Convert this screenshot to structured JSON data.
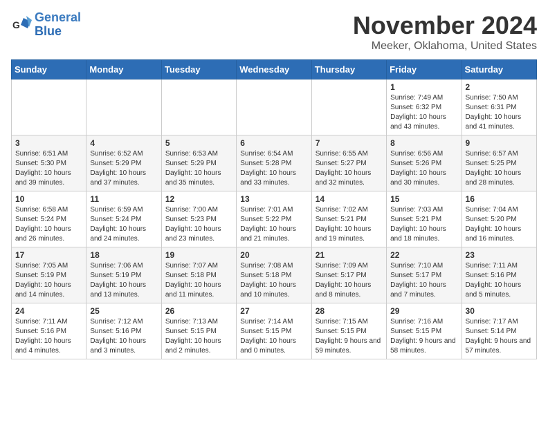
{
  "logo": {
    "line1": "General",
    "line2": "Blue"
  },
  "title": "November 2024",
  "location": "Meeker, Oklahoma, United States",
  "weekdays": [
    "Sunday",
    "Monday",
    "Tuesday",
    "Wednesday",
    "Thursday",
    "Friday",
    "Saturday"
  ],
  "weeks": [
    [
      {
        "day": "",
        "info": ""
      },
      {
        "day": "",
        "info": ""
      },
      {
        "day": "",
        "info": ""
      },
      {
        "day": "",
        "info": ""
      },
      {
        "day": "",
        "info": ""
      },
      {
        "day": "1",
        "info": "Sunrise: 7:49 AM\nSunset: 6:32 PM\nDaylight: 10 hours and 43 minutes."
      },
      {
        "day": "2",
        "info": "Sunrise: 7:50 AM\nSunset: 6:31 PM\nDaylight: 10 hours and 41 minutes."
      }
    ],
    [
      {
        "day": "3",
        "info": "Sunrise: 6:51 AM\nSunset: 5:30 PM\nDaylight: 10 hours and 39 minutes."
      },
      {
        "day": "4",
        "info": "Sunrise: 6:52 AM\nSunset: 5:29 PM\nDaylight: 10 hours and 37 minutes."
      },
      {
        "day": "5",
        "info": "Sunrise: 6:53 AM\nSunset: 5:29 PM\nDaylight: 10 hours and 35 minutes."
      },
      {
        "day": "6",
        "info": "Sunrise: 6:54 AM\nSunset: 5:28 PM\nDaylight: 10 hours and 33 minutes."
      },
      {
        "day": "7",
        "info": "Sunrise: 6:55 AM\nSunset: 5:27 PM\nDaylight: 10 hours and 32 minutes."
      },
      {
        "day": "8",
        "info": "Sunrise: 6:56 AM\nSunset: 5:26 PM\nDaylight: 10 hours and 30 minutes."
      },
      {
        "day": "9",
        "info": "Sunrise: 6:57 AM\nSunset: 5:25 PM\nDaylight: 10 hours and 28 minutes."
      }
    ],
    [
      {
        "day": "10",
        "info": "Sunrise: 6:58 AM\nSunset: 5:24 PM\nDaylight: 10 hours and 26 minutes."
      },
      {
        "day": "11",
        "info": "Sunrise: 6:59 AM\nSunset: 5:24 PM\nDaylight: 10 hours and 24 minutes."
      },
      {
        "day": "12",
        "info": "Sunrise: 7:00 AM\nSunset: 5:23 PM\nDaylight: 10 hours and 23 minutes."
      },
      {
        "day": "13",
        "info": "Sunrise: 7:01 AM\nSunset: 5:22 PM\nDaylight: 10 hours and 21 minutes."
      },
      {
        "day": "14",
        "info": "Sunrise: 7:02 AM\nSunset: 5:21 PM\nDaylight: 10 hours and 19 minutes."
      },
      {
        "day": "15",
        "info": "Sunrise: 7:03 AM\nSunset: 5:21 PM\nDaylight: 10 hours and 18 minutes."
      },
      {
        "day": "16",
        "info": "Sunrise: 7:04 AM\nSunset: 5:20 PM\nDaylight: 10 hours and 16 minutes."
      }
    ],
    [
      {
        "day": "17",
        "info": "Sunrise: 7:05 AM\nSunset: 5:19 PM\nDaylight: 10 hours and 14 minutes."
      },
      {
        "day": "18",
        "info": "Sunrise: 7:06 AM\nSunset: 5:19 PM\nDaylight: 10 hours and 13 minutes."
      },
      {
        "day": "19",
        "info": "Sunrise: 7:07 AM\nSunset: 5:18 PM\nDaylight: 10 hours and 11 minutes."
      },
      {
        "day": "20",
        "info": "Sunrise: 7:08 AM\nSunset: 5:18 PM\nDaylight: 10 hours and 10 minutes."
      },
      {
        "day": "21",
        "info": "Sunrise: 7:09 AM\nSunset: 5:17 PM\nDaylight: 10 hours and 8 minutes."
      },
      {
        "day": "22",
        "info": "Sunrise: 7:10 AM\nSunset: 5:17 PM\nDaylight: 10 hours and 7 minutes."
      },
      {
        "day": "23",
        "info": "Sunrise: 7:11 AM\nSunset: 5:16 PM\nDaylight: 10 hours and 5 minutes."
      }
    ],
    [
      {
        "day": "24",
        "info": "Sunrise: 7:11 AM\nSunset: 5:16 PM\nDaylight: 10 hours and 4 minutes."
      },
      {
        "day": "25",
        "info": "Sunrise: 7:12 AM\nSunset: 5:16 PM\nDaylight: 10 hours and 3 minutes."
      },
      {
        "day": "26",
        "info": "Sunrise: 7:13 AM\nSunset: 5:15 PM\nDaylight: 10 hours and 2 minutes."
      },
      {
        "day": "27",
        "info": "Sunrise: 7:14 AM\nSunset: 5:15 PM\nDaylight: 10 hours and 0 minutes."
      },
      {
        "day": "28",
        "info": "Sunrise: 7:15 AM\nSunset: 5:15 PM\nDaylight: 9 hours and 59 minutes."
      },
      {
        "day": "29",
        "info": "Sunrise: 7:16 AM\nSunset: 5:15 PM\nDaylight: 9 hours and 58 minutes."
      },
      {
        "day": "30",
        "info": "Sunrise: 7:17 AM\nSunset: 5:14 PM\nDaylight: 9 hours and 57 minutes."
      }
    ]
  ]
}
